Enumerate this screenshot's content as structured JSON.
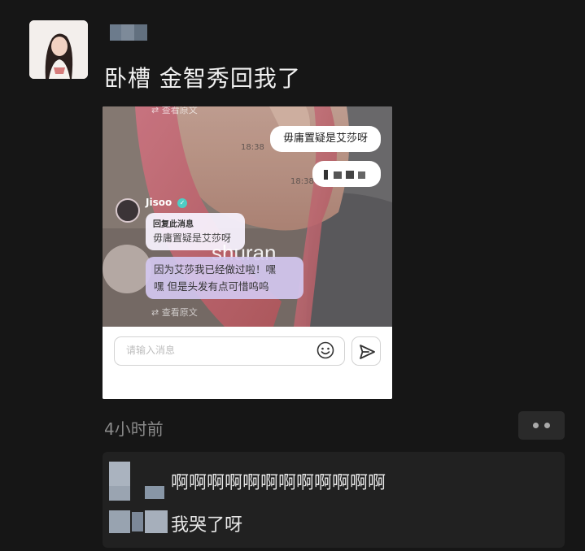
{
  "post": {
    "text": "卧槽 金智秀回我了",
    "time_ago": "4小时前"
  },
  "screenshot": {
    "sent_message": "毋庸置疑是艾莎呀",
    "timestamp_1": "18:38",
    "timestamp_2": "18:38",
    "translate_label": "查看原文",
    "sender_name": "Jisoo",
    "reply_header": "回复此消息",
    "reply_quote": "毋庸置疑是艾莎呀",
    "reply_message_line1": "因为艾莎我已经做过啦！嘿",
    "reply_message_line2": "嘿 但是头发有点可惜呜呜",
    "watermark": "shuran",
    "input_placeholder": "请输入消息"
  },
  "comments": [
    {
      "text": "啊啊啊啊啊啊啊啊啊啊啊啊"
    },
    {
      "text": "我哭了呀"
    }
  ],
  "icons": {
    "emoji": "smiley-icon",
    "send": "send-arrow-icon",
    "more": "more-dots-icon",
    "translate": "translate-icon",
    "verified": "verified-badge-icon"
  },
  "colors": {
    "background": "#161616",
    "comment_panel": "#212121",
    "reply_bubble": "#d4c8f0",
    "verified": "#4ecdc4"
  }
}
